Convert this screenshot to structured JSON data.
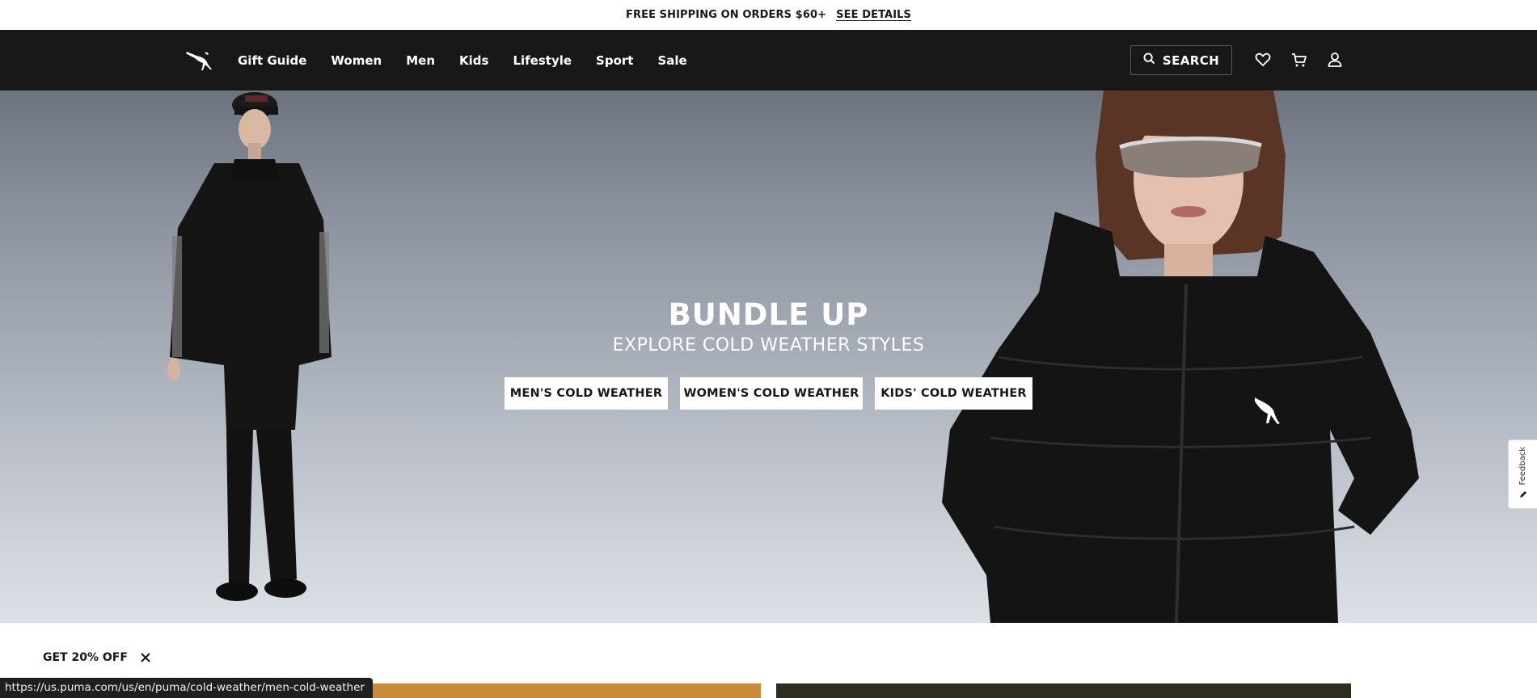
{
  "promo": {
    "text": "FREE SHIPPING ON ORDERS $60+",
    "link": "SEE DETAILS"
  },
  "header": {
    "logo_icon": "puma-cat-logo",
    "nav": [
      "Gift Guide",
      "Women",
      "Men",
      "Kids",
      "Lifestyle",
      "Sport",
      "Sale"
    ],
    "search_label": "SEARCH",
    "icons": [
      "search-icon",
      "wishlist-heart-icon",
      "cart-icon",
      "account-icon"
    ]
  },
  "hero": {
    "title": "BUNDLE UP",
    "subtitle": "EXPLORE COLD WEATHER STYLES",
    "buttons": [
      "MEN'S COLD WEATHER",
      "WOMEN'S COLD WEATHER",
      "KIDS' COLD WEATHER"
    ]
  },
  "feedback": {
    "label": "Feedback"
  },
  "offer": {
    "label": "GET 20% OFF"
  },
  "status_bar": {
    "url": "https://us.puma.com/us/en/puma/cold-weather/men-cold-weather"
  },
  "colors": {
    "header_bg": "#181818",
    "accent_tile": "#c98a3a",
    "dark_tile": "#2f2c20"
  }
}
